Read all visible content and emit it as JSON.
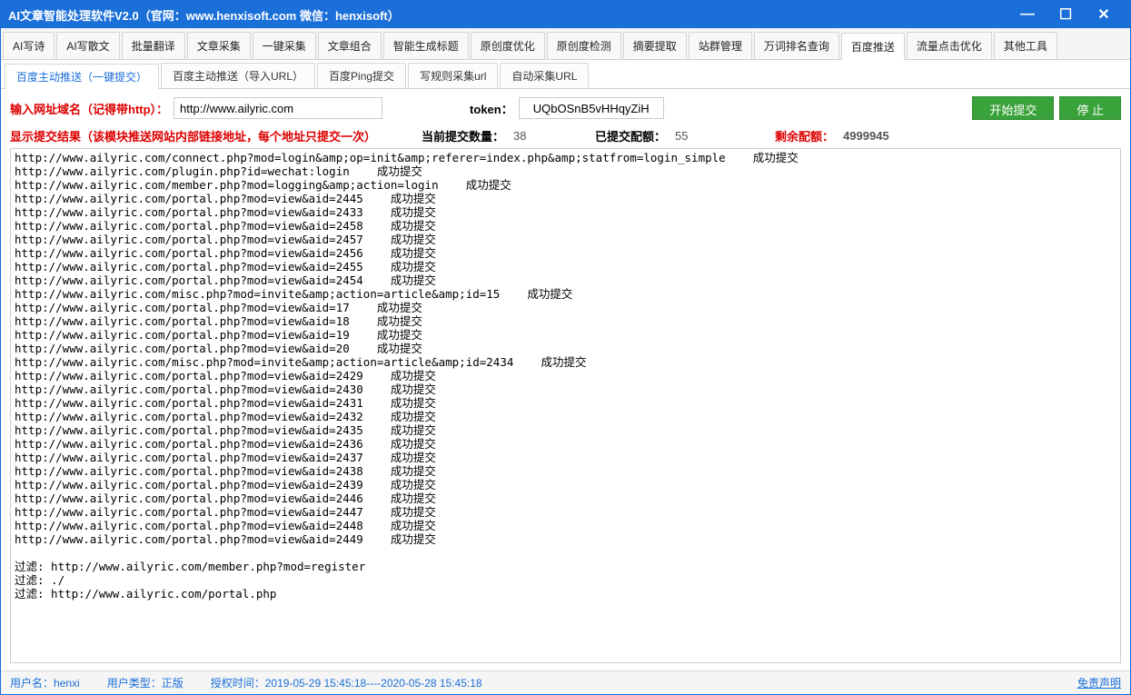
{
  "title": "AI文章智能处理软件V2.0（官网：www.henxisoft.com  微信：henxisoft）",
  "win": {
    "min": "—",
    "max": "☐",
    "close": "✕"
  },
  "mainTabs": [
    "AI写诗",
    "AI写散文",
    "批量翻译",
    "文章采集",
    "一键采集",
    "文章组合",
    "智能生成标题",
    "原创度优化",
    "原创度检测",
    "摘要提取",
    "站群管理",
    "万词排名查询",
    "百度推送",
    "流量点击优化",
    "其他工具"
  ],
  "mainActive": 12,
  "subTabs": [
    "百度主动推送（一键提交）",
    "百度主动推送（导入URL）",
    "百度Ping提交",
    "写规则采集url",
    "自动采集URL"
  ],
  "subActive": 0,
  "inputRow": {
    "domainLabel": "输入网址域名（记得带http）：",
    "domainValue": "http://www.ailyric.com",
    "tokenLabel": "token：",
    "tokenValue": "UQbOSnB5vHHqyZiH",
    "startBtn": "开始提交",
    "stopBtn": "停  止"
  },
  "statusRow": {
    "resultLabel": "显示提交结果（该模块推送网站内部链接地址，每个地址只提交一次）",
    "curLabel": "当前提交数量：",
    "curVal": "38",
    "doneLabel": "已提交配额：",
    "doneVal": "55",
    "leftLabel": "剩余配额：",
    "leftVal": "4999945"
  },
  "logLines": [
    "http://www.ailyric.com/connect.php?mod=login&amp;op=init&amp;referer=index.php&amp;statfrom=login_simple    成功提交",
    "http://www.ailyric.com/plugin.php?id=wechat:login    成功提交",
    "http://www.ailyric.com/member.php?mod=logging&amp;action=login    成功提交",
    "http://www.ailyric.com/portal.php?mod=view&aid=2445    成功提交",
    "http://www.ailyric.com/portal.php?mod=view&aid=2433    成功提交",
    "http://www.ailyric.com/portal.php?mod=view&aid=2458    成功提交",
    "http://www.ailyric.com/portal.php?mod=view&aid=2457    成功提交",
    "http://www.ailyric.com/portal.php?mod=view&aid=2456    成功提交",
    "http://www.ailyric.com/portal.php?mod=view&aid=2455    成功提交",
    "http://www.ailyric.com/portal.php?mod=view&aid=2454    成功提交",
    "http://www.ailyric.com/misc.php?mod=invite&amp;action=article&amp;id=15    成功提交",
    "http://www.ailyric.com/portal.php?mod=view&aid=17    成功提交",
    "http://www.ailyric.com/portal.php?mod=view&aid=18    成功提交",
    "http://www.ailyric.com/portal.php?mod=view&aid=19    成功提交",
    "http://www.ailyric.com/portal.php?mod=view&aid=20    成功提交",
    "http://www.ailyric.com/misc.php?mod=invite&amp;action=article&amp;id=2434    成功提交",
    "http://www.ailyric.com/portal.php?mod=view&aid=2429    成功提交",
    "http://www.ailyric.com/portal.php?mod=view&aid=2430    成功提交",
    "http://www.ailyric.com/portal.php?mod=view&aid=2431    成功提交",
    "http://www.ailyric.com/portal.php?mod=view&aid=2432    成功提交",
    "http://www.ailyric.com/portal.php?mod=view&aid=2435    成功提交",
    "http://www.ailyric.com/portal.php?mod=view&aid=2436    成功提交",
    "http://www.ailyric.com/portal.php?mod=view&aid=2437    成功提交",
    "http://www.ailyric.com/portal.php?mod=view&aid=2438    成功提交",
    "http://www.ailyric.com/portal.php?mod=view&aid=2439    成功提交",
    "http://www.ailyric.com/portal.php?mod=view&aid=2446    成功提交",
    "http://www.ailyric.com/portal.php?mod=view&aid=2447    成功提交",
    "http://www.ailyric.com/portal.php?mod=view&aid=2448    成功提交",
    "http://www.ailyric.com/portal.php?mod=view&aid=2449    成功提交",
    "",
    "过滤: http://www.ailyric.com/member.php?mod=register",
    "过滤: ./",
    "过滤: http://www.ailyric.com/portal.php"
  ],
  "footer": {
    "userLabel": "用户名：",
    "userVal": "henxi",
    "typeLabel": "用户类型：",
    "typeVal": "正版",
    "authLabel": "授权时间：",
    "authVal": "2019-05-29 15:45:18----2020-05-28 15:45:18",
    "disclaimer": "免责声明"
  }
}
